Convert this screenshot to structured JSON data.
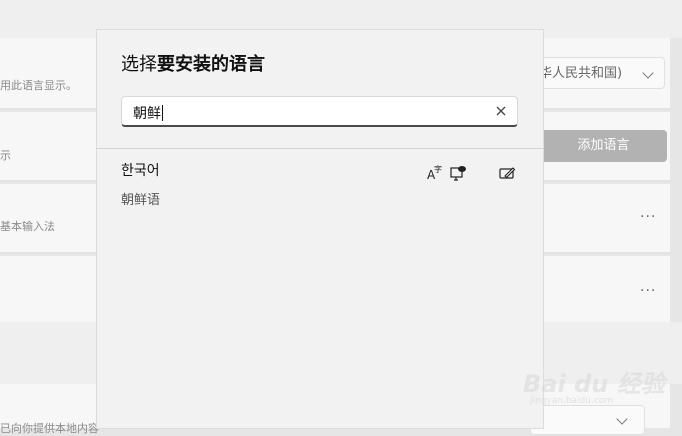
{
  "background": {
    "display_language_hint": "用此语言显示。",
    "region_value": "华人民共和国)",
    "row2_hint": "示",
    "add_language_label": "添加语言",
    "row3_hint": "基本输入法",
    "more_label": "···",
    "bottom_hint": "已向你提供本地内容"
  },
  "dialog": {
    "title_prefix": "选择",
    "title_bold": "要安装的语言",
    "search": {
      "value": "朝鲜",
      "clear_icon": "close-icon"
    },
    "results": [
      {
        "native_name": "한국어",
        "localized_name": "朝鲜语",
        "features": [
          "text-to-speech-icon",
          "display-language-icon",
          "handwriting-icon"
        ]
      }
    ]
  },
  "watermark": {
    "main": "Bai du 经验",
    "sub": "jingyan.baidu.com"
  }
}
